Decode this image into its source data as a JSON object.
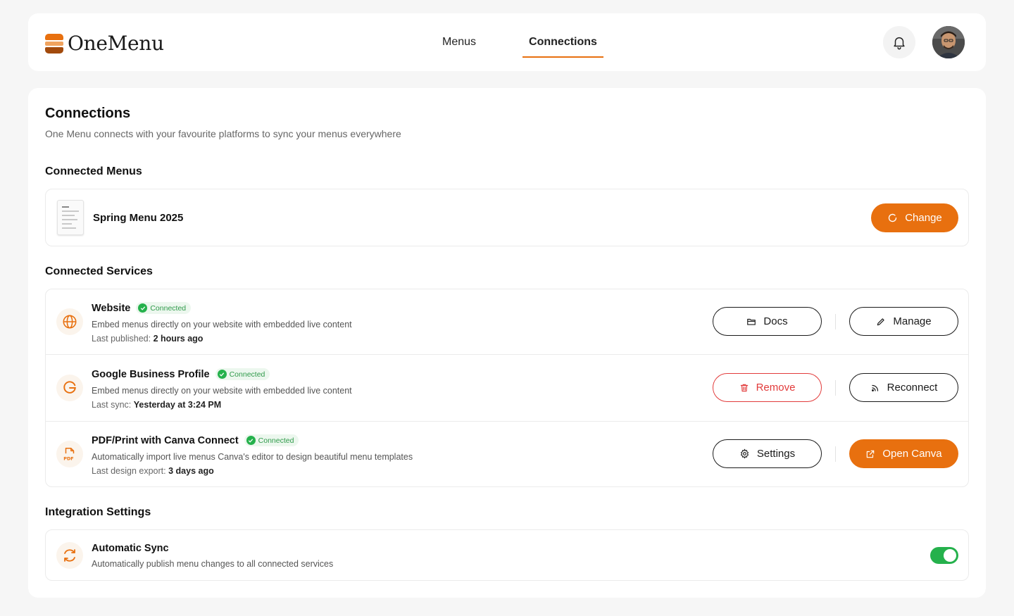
{
  "app": {
    "name": "OneMenu"
  },
  "nav": {
    "tabs": [
      {
        "label": "Menus",
        "active": false
      },
      {
        "label": "Connections",
        "active": true
      }
    ]
  },
  "page": {
    "title": "Connections",
    "subtitle": "One Menu connects with your favourite platforms to sync your menus everywhere"
  },
  "connected_menus": {
    "title": "Connected Menus",
    "menu_name": "Spring Menu 2025",
    "change_label": "Change"
  },
  "connected_services": {
    "title": "Connected Services",
    "items": [
      {
        "icon": "globe-icon",
        "name": "Website",
        "status": "Connected",
        "description": "Embed menus directly on your website with embedded live content",
        "meta_label": "Last published:",
        "meta_value": "2 hours ago",
        "action1": "Docs",
        "action2": "Manage"
      },
      {
        "icon": "google-icon",
        "name": "Google Business Profile",
        "status": "Connected",
        "description": "Embed menus directly on your website with embedded live content",
        "meta_label": "Last sync:",
        "meta_value": "Yesterday at 3:24 PM",
        "action1": "Remove",
        "action2": "Reconnect"
      },
      {
        "icon": "pdf-icon",
        "name": "PDF/Print with Canva Connect",
        "status": "Connected",
        "description": "Automatically import live menus Canva's editor to design beautiful menu templates",
        "meta_label": "Last design export:",
        "meta_value": "3 days ago",
        "action1": "Settings",
        "action2": "Open Canva"
      }
    ]
  },
  "integration_settings": {
    "title": "Integration Settings",
    "auto_sync": {
      "name": "Automatic Sync",
      "description": "Automatically publish menu changes to all connected services",
      "enabled": true
    }
  },
  "colors": {
    "accent": "#e8700f",
    "success": "#25b14c",
    "danger": "#e23b3b"
  }
}
